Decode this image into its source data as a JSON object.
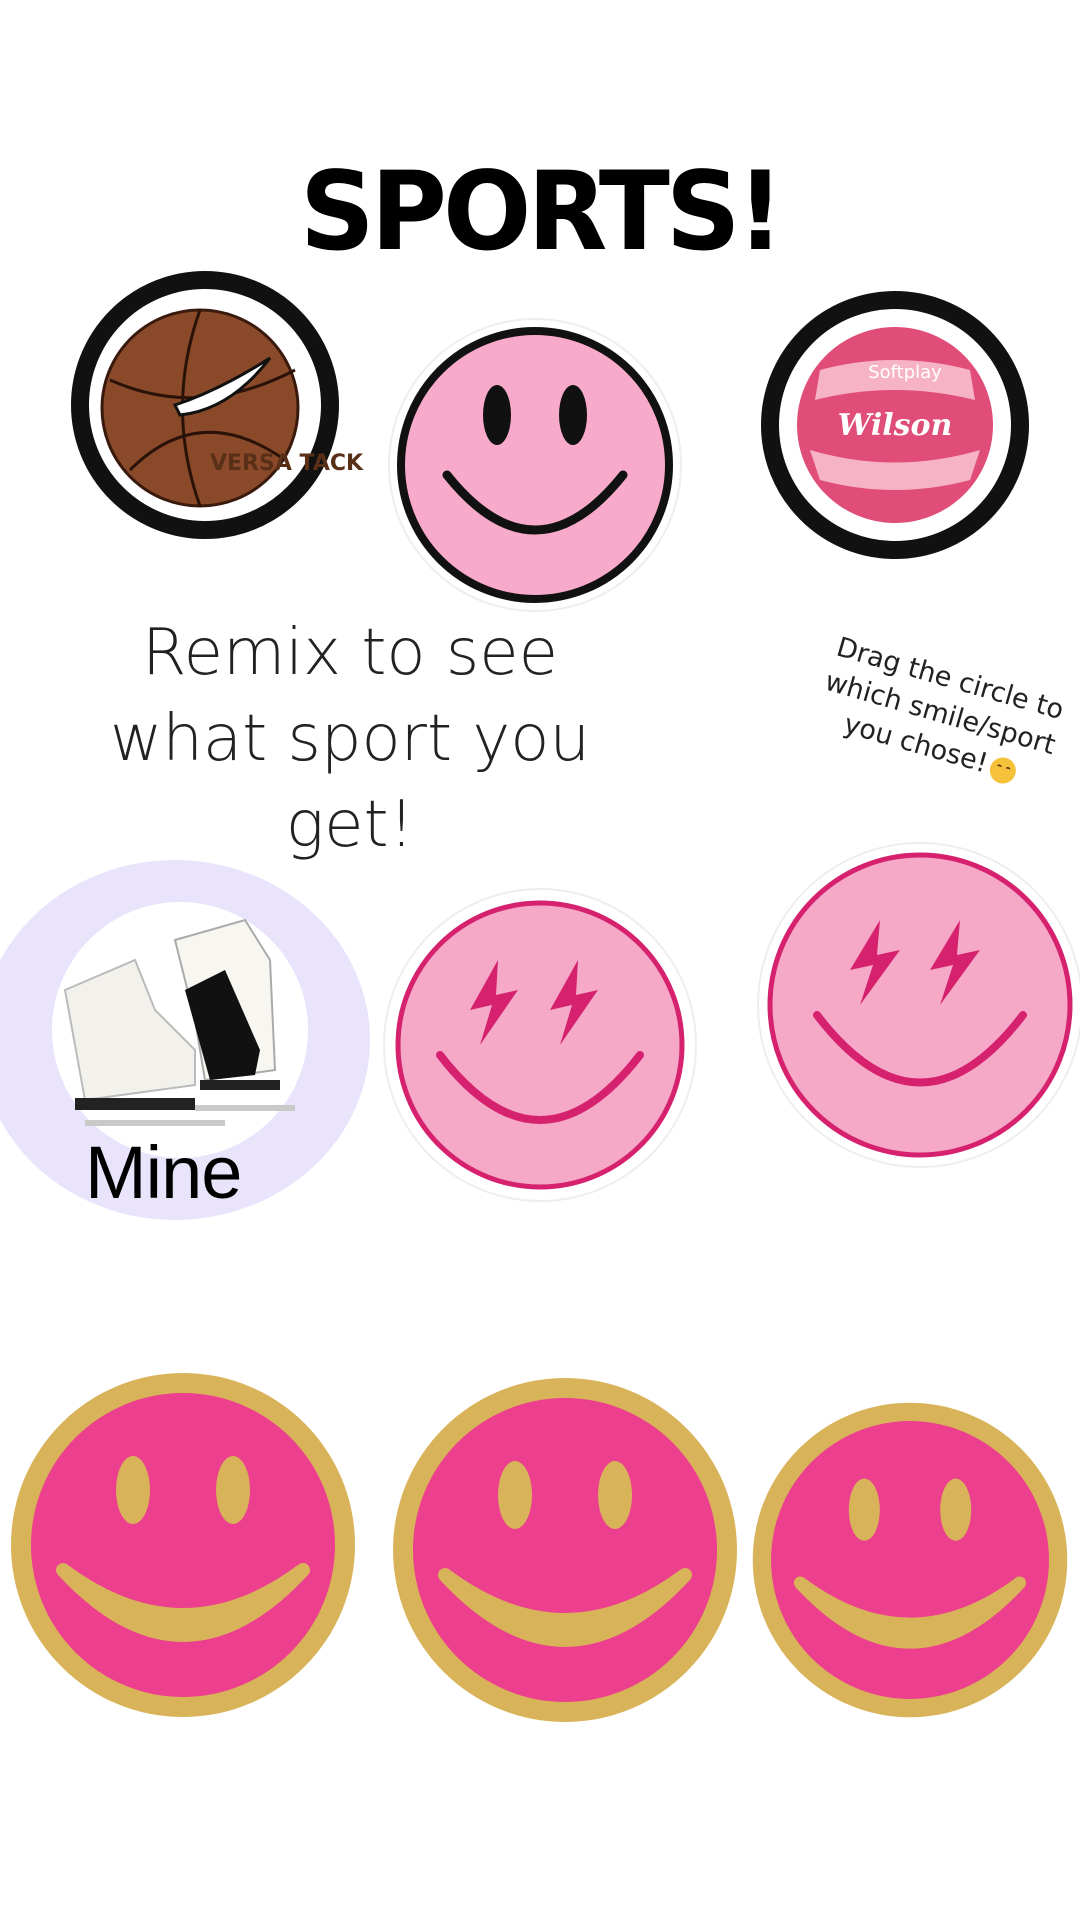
{
  "title": "SPORTS!",
  "instruction": {
    "line1": "Remix to see",
    "line2": "what sport you",
    "line3": "get!"
  },
  "drag_note": {
    "line1": "Drag the circle to",
    "line2": "which smile/sport",
    "line3": "you chose!",
    "emoji": "smiling-face-emoji"
  },
  "sticker_row_1": [
    {
      "icon": "basketball-icon",
      "brand_text": "VERSA TACK"
    },
    {
      "icon": "pink-smiley-face-icon"
    },
    {
      "icon": "volleyball-icon",
      "brand_text": "Wilson",
      "sub_text": "Softplay"
    }
  ],
  "sticker_row_2": [
    {
      "icon": "ice-skates-icon"
    },
    {
      "icon": "lightning-eyes-smiley-icon"
    },
    {
      "icon": "lightning-eyes-smiley-icon"
    }
  ],
  "mine_label": "Mine",
  "sticker_row_3": [
    {
      "icon": "gold-pink-smiley-icon"
    },
    {
      "icon": "gold-pink-smiley-icon"
    },
    {
      "icon": "gold-pink-smiley-icon"
    }
  ],
  "colors": {
    "pink_light": "#f8aacb",
    "hot_pink": "#e91f7a",
    "gold": "#d9b35a",
    "lavender": "#e9e4fb"
  }
}
